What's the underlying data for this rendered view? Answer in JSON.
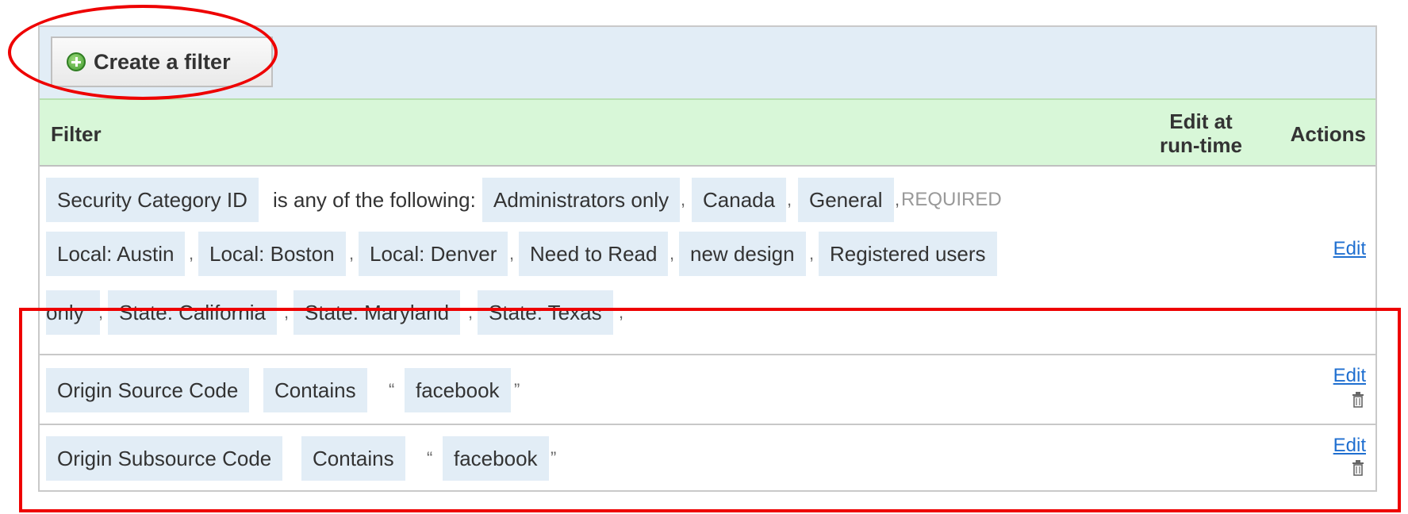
{
  "toolbar": {
    "create_label": "Create a filter"
  },
  "table": {
    "headers": {
      "filter": "Filter",
      "edit_at_runtime_line1": "Edit at",
      "edit_at_runtime_line2": "run-time",
      "actions": "Actions"
    }
  },
  "rows": [
    {
      "field": "Security Category ID",
      "operator": "is any of the following:",
      "values": [
        "Administrators only",
        "Canada",
        "General",
        "Local: Austin",
        "Local: Boston",
        "Local: Denver",
        "Need to Read",
        "new design",
        "Registered users",
        "only",
        "State: California",
        "State: Maryland",
        "State: Texas"
      ],
      "required": "REQUIRED",
      "edit": "Edit"
    },
    {
      "field": "Origin Source Code",
      "operator": "Contains",
      "open_quote": "“",
      "value": "facebook",
      "close_quote": "”",
      "edit": "Edit"
    },
    {
      "field": "Origin Subsource Code",
      "operator": "Contains",
      "open_quote": "“",
      "value": "facebook",
      "close_quote": "”",
      "edit": "Edit"
    }
  ],
  "punctuation": {
    "comma": ","
  },
  "icons": {
    "create": "plus-circle-icon",
    "delete": "trash-icon"
  },
  "colors": {
    "highlight": "#ee0000",
    "link": "#1f6fd0",
    "header_bg": "#d8f7d8",
    "chip_bg": "#e2edf6"
  }
}
